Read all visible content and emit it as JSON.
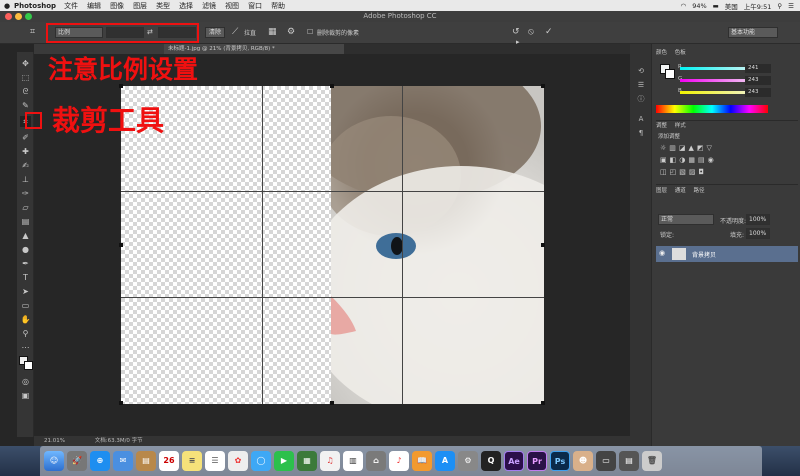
{
  "menubar": {
    "app": "Photoshop",
    "items": [
      "文件",
      "编辑",
      "图像",
      "图层",
      "类型",
      "选择",
      "滤镜",
      "视图",
      "窗口",
      "帮助"
    ],
    "battery": "94%",
    "input_method": "美国",
    "clock": "上午9:51"
  },
  "window": {
    "title": "Adobe Photoshop CC"
  },
  "options": {
    "ratio_select": "比例",
    "swap_label": "⇄",
    "clear_button": "清除",
    "straighten_label": "拉直",
    "delete_cropped_label": "删除裁剪的像素",
    "workspace": "基本功能"
  },
  "document_tab": {
    "title": "未标题-1.jpg @ 21% (背景拷贝, RGB/8) *"
  },
  "annotations": {
    "ratio_note": "注意比例设置",
    "crop_tool_note": "裁剪工具"
  },
  "status": {
    "zoom": "21.01%",
    "doc": "文档:63.3M/0 字节"
  },
  "panels": {
    "color_tabs": [
      "颜色",
      "色板"
    ],
    "rgb": [
      {
        "label": "R",
        "value": "241"
      },
      {
        "label": "G",
        "value": "243"
      },
      {
        "label": "B",
        "value": "243"
      }
    ],
    "adjust_tabs": [
      "调整",
      "样式"
    ],
    "adjust_title": "添加调整",
    "layers_tabs": [
      "图层",
      "通道",
      "路径"
    ],
    "blend_mode": "正常",
    "opacity_label": "不透明度:",
    "opacity": "100%",
    "fill_label": "填充:",
    "fill": "100%",
    "layer_name": "背景拷贝",
    "lock_label": "锁定:"
  },
  "dock": {
    "calendar_day": "26",
    "apps": [
      "Finder",
      "Launchpad",
      "Safari",
      "Mail",
      "Contacts",
      "Calendar",
      "Notes",
      "Reminders",
      "Photos",
      "Messages",
      "FaceTime",
      "iTunes",
      "iBooks",
      "App Store",
      "System Preferences",
      "QuickTime",
      "Ae",
      "Pr",
      "Ps",
      "Trash"
    ]
  },
  "colors": {
    "annotation_red": "#f01010",
    "layer_selected": "#5a6f8f",
    "ae": "#2b0f4a",
    "pr": "#2a1247",
    "ps": "#0a2a4a"
  }
}
